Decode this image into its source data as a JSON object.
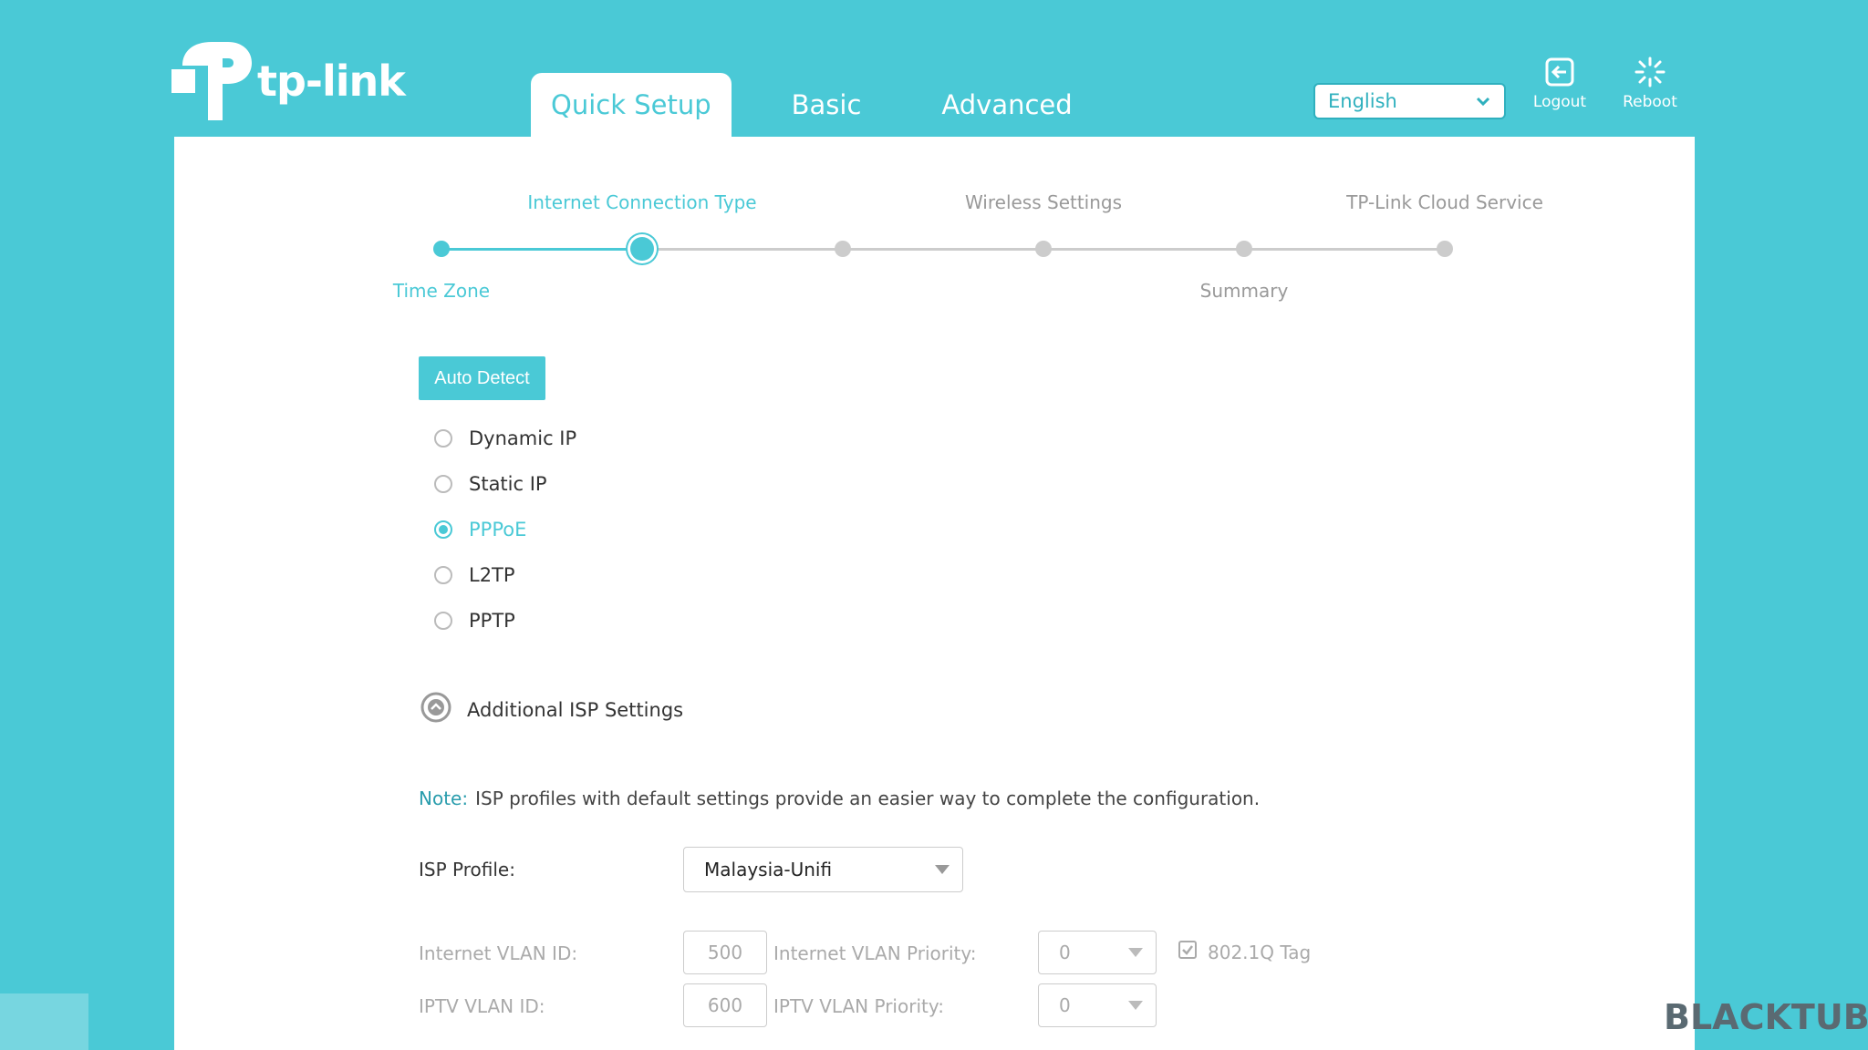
{
  "brand": {
    "name": "tp-link"
  },
  "nav": {
    "tabs": [
      {
        "label": "Quick Setup",
        "active": true
      },
      {
        "label": "Basic",
        "active": false
      },
      {
        "label": "Advanced",
        "active": false
      }
    ]
  },
  "header": {
    "language": {
      "selected": "English"
    },
    "logout_label": "Logout",
    "reboot_label": "Reboot"
  },
  "progress": {
    "steps": [
      {
        "label": "Time Zone",
        "state": "done"
      },
      {
        "label": "Internet Connection Type",
        "state": "current"
      },
      {
        "label": "",
        "state": "todo"
      },
      {
        "label": "Wireless Settings",
        "state": "todo"
      },
      {
        "label": "Summary",
        "state": "todo"
      },
      {
        "label": "TP-Link Cloud Service",
        "state": "todo"
      }
    ]
  },
  "connection": {
    "auto_detect_label": "Auto Detect",
    "options": [
      {
        "label": "Dynamic IP",
        "checked": false
      },
      {
        "label": "Static IP",
        "checked": false
      },
      {
        "label": "PPPoE",
        "checked": true
      },
      {
        "label": "L2TP",
        "checked": false
      },
      {
        "label": "PPTP",
        "checked": false
      }
    ]
  },
  "isp": {
    "toggle_label": "Additional ISP Settings",
    "note_key": "Note:",
    "note_text": "ISP profiles with default settings provide an easier way to complete the configuration.",
    "profile_label": "ISP Profile:",
    "profile_value": "Malaysia-Unifi",
    "internet_vlan_id_label": "Internet VLAN ID:",
    "internet_vlan_id_value": "500",
    "internet_vlan_priority_label": "Internet VLAN Priority:",
    "internet_vlan_priority_value": "0",
    "tag_label": "802.1Q Tag",
    "tag_checked": true,
    "iptv_vlan_id_label": "IPTV VLAN ID:",
    "iptv_vlan_id_value": "600",
    "iptv_vlan_priority_label": "IPTV VLAN Priority:",
    "iptv_vlan_priority_value": "0"
  },
  "watermark": {
    "text": "BLACKTUBI"
  },
  "colors": {
    "accent": "#4ac9d6",
    "muted": "#aaaaaa",
    "track": "#cccccc"
  }
}
